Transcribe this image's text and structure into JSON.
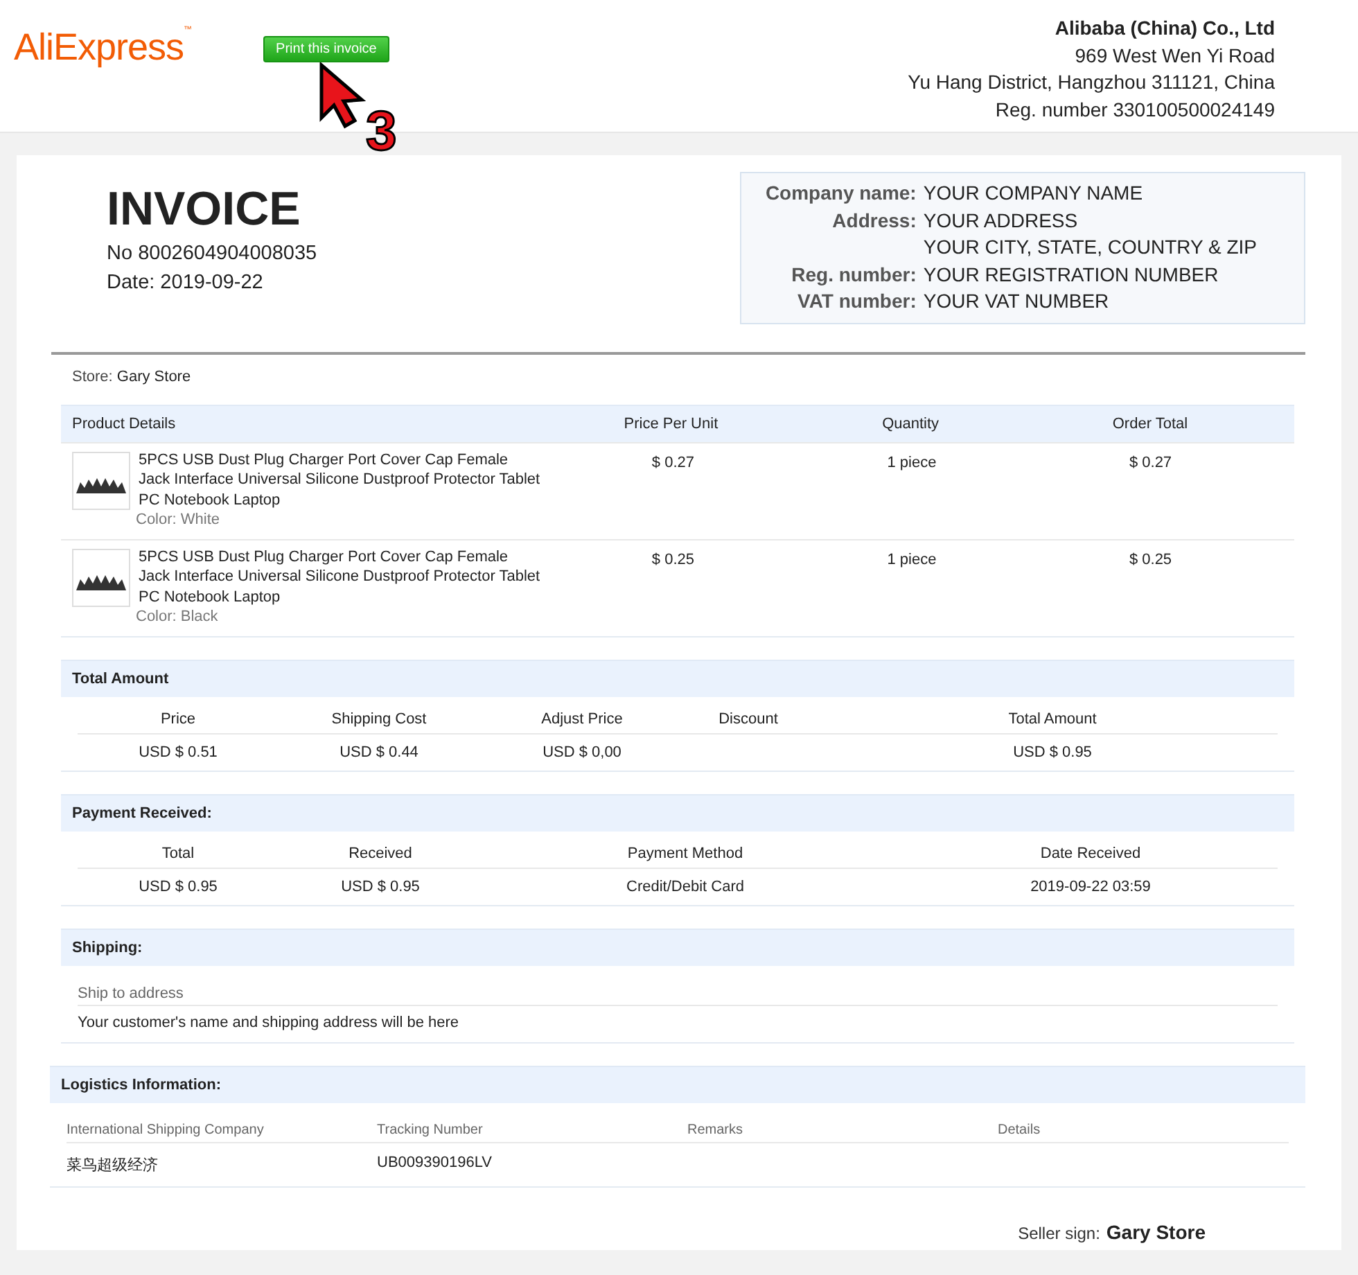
{
  "header": {
    "logo": "AliExpress",
    "logo_mark": "™",
    "print_button": "Print this invoice",
    "annotation": "3",
    "company": {
      "name": "Alibaba (China) Co., Ltd",
      "lines": [
        "969 West Wen Yi Road",
        "Yu Hang District, Hangzhou 311121, China",
        "Reg. number 330100500024149"
      ]
    }
  },
  "invoice": {
    "title": "INVOICE",
    "number": "No 8002604904008035",
    "date": "Date: 2019-09-22",
    "buyer": [
      {
        "label": "Company name:",
        "value": "YOUR COMPANY NAME"
      },
      {
        "label": "Address:",
        "value": "YOUR ADDRESS"
      },
      {
        "value": "YOUR CITY, STATE, COUNTRY & ZIP"
      },
      {
        "label": "Reg. number:",
        "value": "YOUR REGISTRATION NUMBER"
      },
      {
        "label": "VAT number:",
        "value": "YOUR VAT NUMBER"
      }
    ]
  },
  "store": {
    "label": "Store:",
    "name": "Gary Store"
  },
  "products": {
    "columns": [
      "Product Details",
      "Price Per Unit",
      "Quantity",
      "Order Total"
    ],
    "rows": [
      {
        "title": "5PCS USB Dust Plug Charger Port Cover Cap Female Jack Interface Universal Silicone Dustproof Protector Tablet PC Notebook Laptop",
        "variant": "Color: White",
        "price": "$ 0.27",
        "quantity": "1 piece",
        "total": "$ 0.27"
      },
      {
        "title": "5PCS USB Dust Plug Charger Port Cover Cap Female Jack Interface Universal Silicone Dustproof Protector Tablet PC Notebook Laptop",
        "variant": "Color: Black",
        "price": "$ 0.25",
        "quantity": "1 piece",
        "total": "$ 0.25"
      }
    ]
  },
  "total_amount": {
    "title": "Total Amount",
    "columns": [
      {
        "header": "Price",
        "value": "USD $ 0.51"
      },
      {
        "header": "Shipping Cost",
        "value": "USD $ 0.44"
      },
      {
        "header": "Adjust Price",
        "value": "USD $ 0,00"
      },
      {
        "header": "Discount"
      },
      {
        "header": "Total Amount",
        "value": "USD $ 0.95"
      }
    ]
  },
  "payment": {
    "title": "Payment Received:",
    "columns": [
      "Total",
      "Received",
      "Payment Method",
      "Date Received"
    ],
    "values": [
      "USD $ 0.95",
      "USD $ 0.95",
      "Credit/Debit Card",
      "2019-09-22 03:59"
    ]
  },
  "shipping": {
    "title": "Shipping:",
    "label": "Ship to address",
    "address": "Your customer's name and shipping address will be here"
  },
  "logistics": {
    "title": "Logistics Information:",
    "columns": [
      {
        "header": "International Shipping Company",
        "value": "菜鸟超级经济"
      },
      {
        "header": "Tracking Number",
        "value": "UB009390196LV"
      },
      {
        "header": "Remarks"
      },
      {
        "header": "Details"
      }
    ]
  },
  "seller": {
    "label": "Seller sign:",
    "name": "Gary Store"
  }
}
